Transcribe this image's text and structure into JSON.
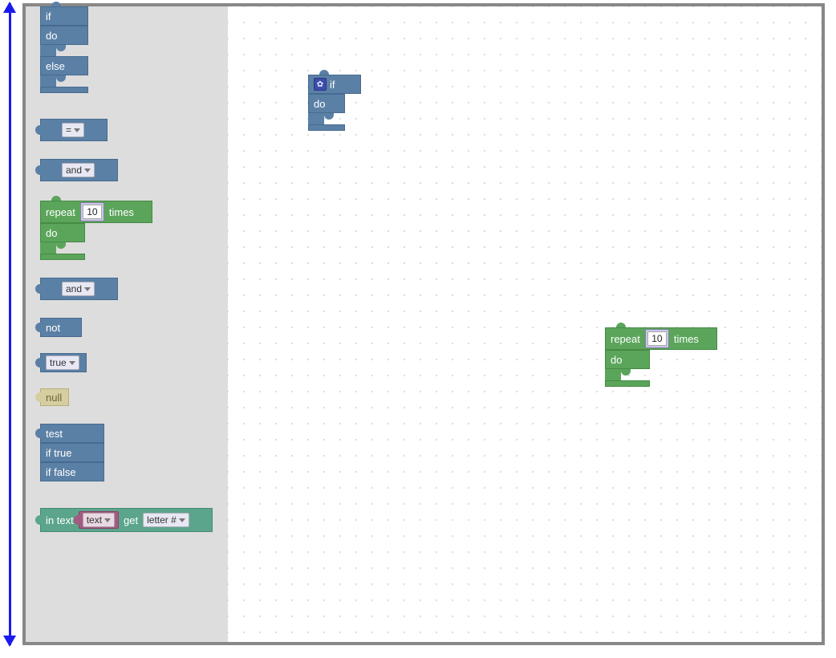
{
  "colors": {
    "logic": "#5b80a5",
    "loops": "#5ba55b",
    "text": "#5ba58c",
    "null": "#d6cea0",
    "var": "#a55b80",
    "arrow": "#1a1af0"
  },
  "toolbox": {
    "if_do_else": {
      "if": "if",
      "do": "do",
      "else": "else"
    },
    "compare": {
      "op": "="
    },
    "and1": {
      "op": "and"
    },
    "repeat": {
      "repeat": "repeat",
      "value": "10",
      "times": "times",
      "do": "do"
    },
    "and2": {
      "op": "and"
    },
    "not": {
      "label": "not"
    },
    "bool": {
      "value": "true"
    },
    "null": {
      "label": "null"
    },
    "ternary": {
      "test": "test",
      "if_true": "if true",
      "if_false": "if false"
    },
    "text_get": {
      "in_text": "in text",
      "var": "text",
      "get": "get",
      "mode": "letter #"
    }
  },
  "workspace": {
    "if_block": {
      "if": "if",
      "do": "do"
    },
    "repeat_block": {
      "repeat": "repeat",
      "value": "10",
      "times": "times",
      "do": "do"
    }
  }
}
